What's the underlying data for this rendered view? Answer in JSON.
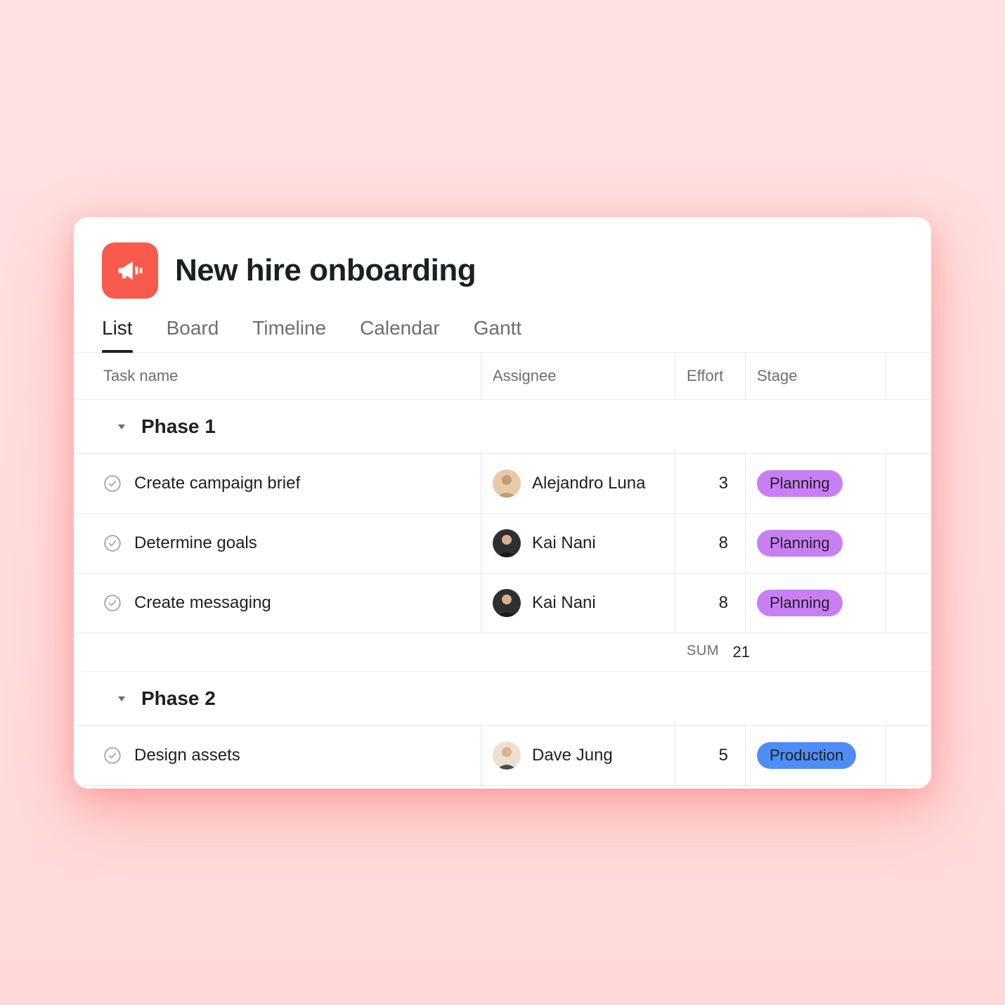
{
  "project": {
    "title": "New hire onboarding",
    "icon": "megaphone-icon"
  },
  "tabs": [
    {
      "label": "List",
      "active": true
    },
    {
      "label": "Board",
      "active": false
    },
    {
      "label": "Timeline",
      "active": false
    },
    {
      "label": "Calendar",
      "active": false
    },
    {
      "label": "Gantt",
      "active": false
    }
  ],
  "columns": {
    "task": "Task name",
    "assignee": "Assignee",
    "effort": "Effort",
    "stage": "Stage"
  },
  "sections": [
    {
      "name": "Phase 1",
      "tasks": [
        {
          "name": "Create campaign brief",
          "assignee": "Alejandro Luna",
          "avatar_bg": "#e8c9a8",
          "effort": "3",
          "stage": "Planning",
          "stage_type": "planning"
        },
        {
          "name": "Determine goals",
          "assignee": "Kai Nani",
          "avatar_bg": "#3a3a3a",
          "effort": "8",
          "stage": "Planning",
          "stage_type": "planning"
        },
        {
          "name": "Create messaging",
          "assignee": "Kai Nani",
          "avatar_bg": "#3a3a3a",
          "effort": "8",
          "stage": "Planning",
          "stage_type": "planning"
        }
      ],
      "sum_label": "SUM",
      "sum_value": "21"
    },
    {
      "name": "Phase 2",
      "tasks": [
        {
          "name": "Design assets",
          "assignee": "Dave Jung",
          "avatar_bg": "#d8c0a0",
          "effort": "5",
          "stage": "Production",
          "stage_type": "production"
        }
      ]
    }
  ]
}
